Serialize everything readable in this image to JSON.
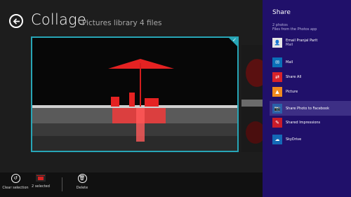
{
  "header": {
    "title": "Collage",
    "subtitle": "Pictures library   4 files"
  },
  "appbar": {
    "buttons": [
      {
        "label": "Clear selection",
        "icon": "clear-selection-icon"
      },
      {
        "label": "2 selected",
        "icon": "selected-thumbnails-icon"
      },
      {
        "label": "Delete",
        "icon": "trash-icon"
      }
    ]
  },
  "share": {
    "title": "Share",
    "count": "2 photos",
    "source": "Files from the Photos app",
    "targets": [
      {
        "label": "Email Pranjal Parit",
        "sub": "Mail",
        "icon": "contact-avatar-icon",
        "color": "#e6e6e6"
      },
      {
        "label": "Mail",
        "sub": "",
        "icon": "mail-icon",
        "color": "#0a6fb8"
      },
      {
        "label": "Share All",
        "sub": "",
        "icon": "share-all-icon",
        "color": "#d8232a"
      },
      {
        "label": "Picture",
        "sub": "",
        "icon": "picture-icon",
        "color": "#f08a1e"
      },
      {
        "label": "Share Photo to Facebook",
        "sub": "",
        "icon": "facebook-share-icon",
        "color": "#2a60a8"
      },
      {
        "label": "Shared Impressions",
        "sub": "",
        "icon": "shared-impressions-icon",
        "color": "#c81c2a"
      },
      {
        "label": "SkyDrive",
        "sub": "",
        "icon": "skydrive-cloud-icon",
        "color": "#1469b6"
      }
    ]
  },
  "colors": {
    "accent": "#27a5b6",
    "share_pane": "#20106a",
    "highlight": "#3d2f85"
  }
}
